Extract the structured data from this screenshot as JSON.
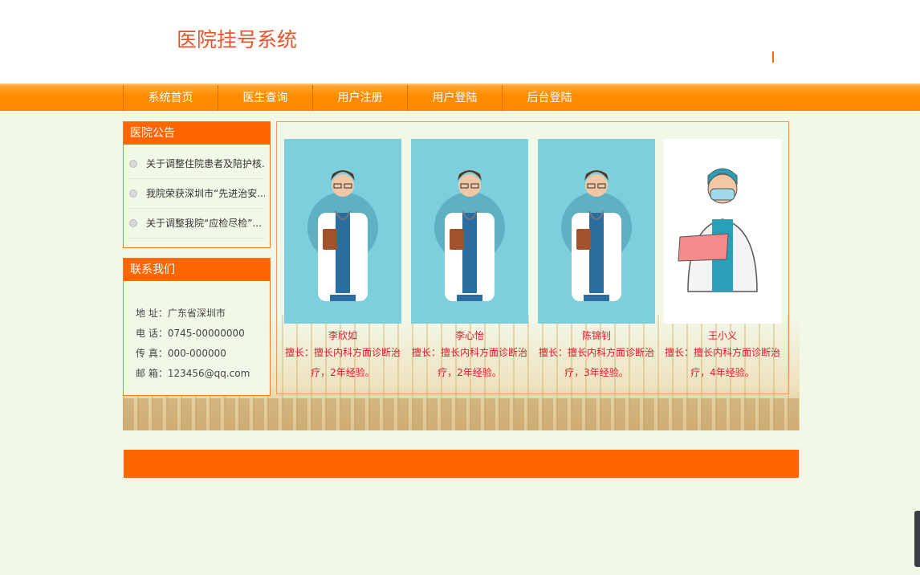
{
  "header": {
    "site_title": "医院挂号系统"
  },
  "nav": {
    "items": [
      "系统首页",
      "医生查询",
      "用户注册",
      "用户登陆",
      "后台登陆"
    ]
  },
  "notice": {
    "title": "医院公告",
    "items": [
      "关于调整住院患者及陪护核...",
      "我院荣获深圳市“先进治安...",
      "关于调整我院“应检尽检”..."
    ]
  },
  "contact": {
    "title": "联系我们",
    "address": "地 址：广东省深圳市",
    "phone": "电 话：0745-00000000",
    "fax": "传 真：000-000000",
    "email": "邮 箱：123456@qq.com"
  },
  "doctors": [
    {
      "name": "李欣如",
      "desc": "擅长：擅长内科方面诊断治疗，2年经验。",
      "icon": "doctor-cartoon"
    },
    {
      "name": "李心怡",
      "desc": "擅长：擅长内科方面诊断治疗，2年经验。",
      "icon": "doctor-cartoon"
    },
    {
      "name": "陈锦钊",
      "desc": "擅长：擅长内科方面诊断治疗，3年经验。",
      "icon": "doctor-cartoon"
    },
    {
      "name": "王小义",
      "desc": "擅长：擅长内科方面诊断治疗，4年经验。",
      "icon": "doctor-masked"
    }
  ],
  "colors": {
    "accent": "#ff6600",
    "nav": "#ff8c00",
    "title": "#e8542a",
    "doc_text": "#e8142a"
  }
}
